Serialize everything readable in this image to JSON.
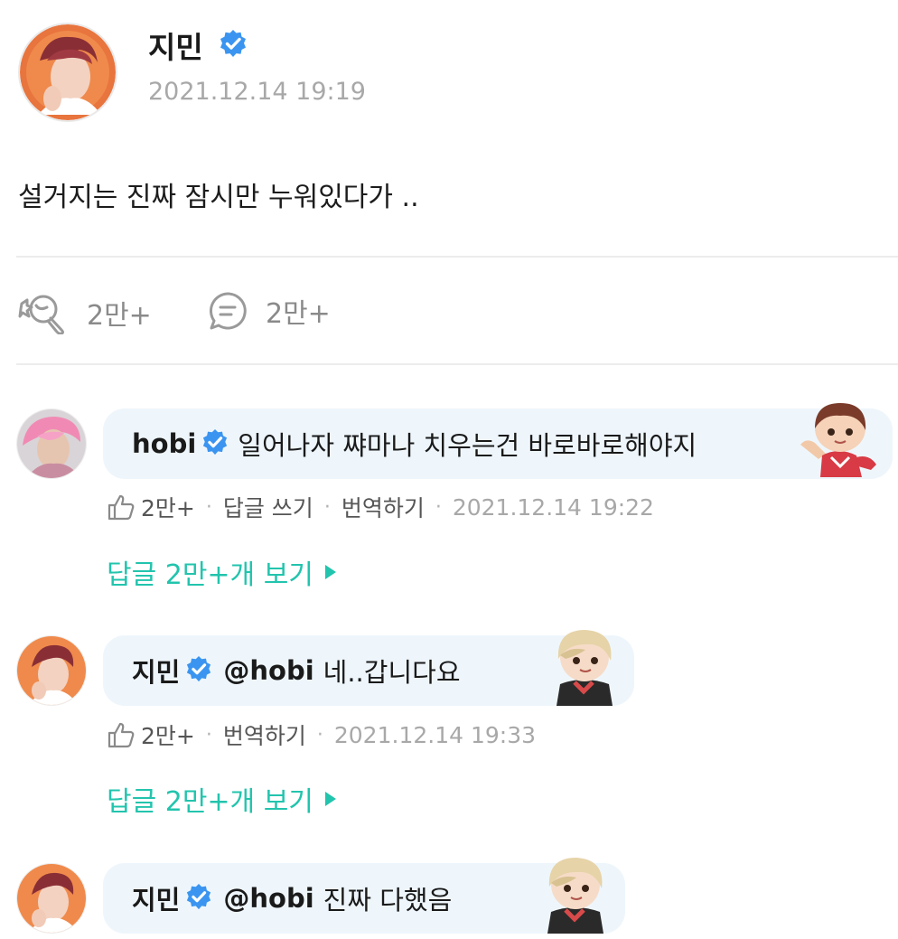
{
  "post": {
    "author": "지민",
    "timestamp": "2021.12.14 19:19",
    "body": "설거지는 진짜 잠시만 누워있다가 ..",
    "likes": "2만+",
    "comments": "2만+",
    "icons": {
      "like": "cheer-icon",
      "comment": "comment-bubble-icon",
      "verified": "verified-badge-icon"
    }
  },
  "comments": [
    {
      "author": "hobi",
      "mention": "",
      "text": "일어나자 쨔마나 치우는건 바로바로해야지",
      "likes": "2만+",
      "reply_label": "답글 쓰기",
      "translate_label": "번역하기",
      "timestamp": "2021.12.14 19:22",
      "view_replies": "답글 2만+개 보기"
    },
    {
      "author": "지민",
      "mention": "@hobi",
      "text": "네..갑니다요",
      "likes": "2만+",
      "translate_label": "번역하기",
      "timestamp": "2021.12.14 19:33",
      "view_replies": "답글 2만+개 보기"
    },
    {
      "author": "지민",
      "mention": "@hobi",
      "text": "진짜 다했음"
    }
  ],
  "colors": {
    "accent": "#22c4ad",
    "verified": "#3b95f0",
    "bubble": "#eef6fc"
  }
}
